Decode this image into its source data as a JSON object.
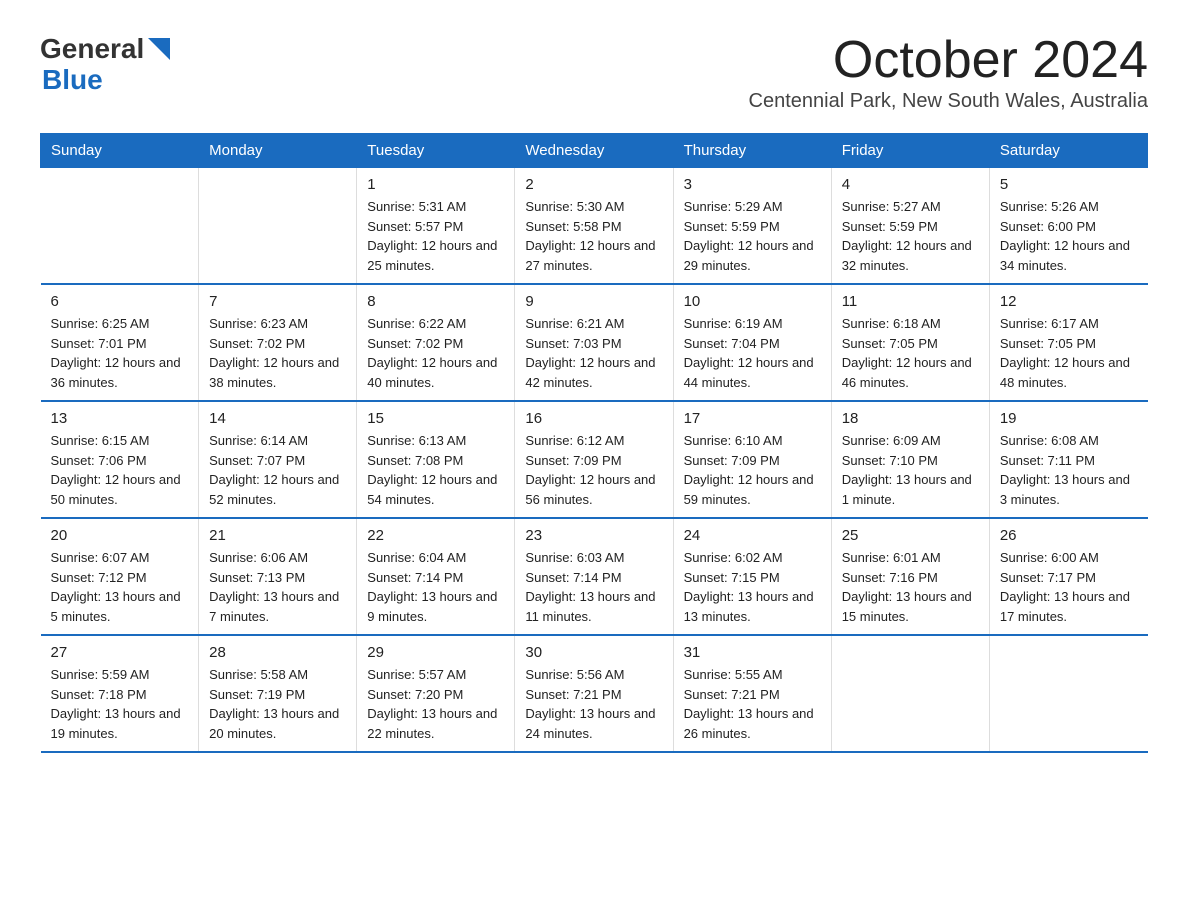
{
  "logo": {
    "general": "General",
    "blue": "Blue"
  },
  "title": "October 2024",
  "location": "Centennial Park, New South Wales, Australia",
  "headers": [
    "Sunday",
    "Monday",
    "Tuesday",
    "Wednesday",
    "Thursday",
    "Friday",
    "Saturday"
  ],
  "weeks": [
    [
      {
        "day": "",
        "sunrise": "",
        "sunset": "",
        "daylight": ""
      },
      {
        "day": "",
        "sunrise": "",
        "sunset": "",
        "daylight": ""
      },
      {
        "day": "1",
        "sunrise": "Sunrise: 5:31 AM",
        "sunset": "Sunset: 5:57 PM",
        "daylight": "Daylight: 12 hours and 25 minutes."
      },
      {
        "day": "2",
        "sunrise": "Sunrise: 5:30 AM",
        "sunset": "Sunset: 5:58 PM",
        "daylight": "Daylight: 12 hours and 27 minutes."
      },
      {
        "day": "3",
        "sunrise": "Sunrise: 5:29 AM",
        "sunset": "Sunset: 5:59 PM",
        "daylight": "Daylight: 12 hours and 29 minutes."
      },
      {
        "day": "4",
        "sunrise": "Sunrise: 5:27 AM",
        "sunset": "Sunset: 5:59 PM",
        "daylight": "Daylight: 12 hours and 32 minutes."
      },
      {
        "day": "5",
        "sunrise": "Sunrise: 5:26 AM",
        "sunset": "Sunset: 6:00 PM",
        "daylight": "Daylight: 12 hours and 34 minutes."
      }
    ],
    [
      {
        "day": "6",
        "sunrise": "Sunrise: 6:25 AM",
        "sunset": "Sunset: 7:01 PM",
        "daylight": "Daylight: 12 hours and 36 minutes."
      },
      {
        "day": "7",
        "sunrise": "Sunrise: 6:23 AM",
        "sunset": "Sunset: 7:02 PM",
        "daylight": "Daylight: 12 hours and 38 minutes."
      },
      {
        "day": "8",
        "sunrise": "Sunrise: 6:22 AM",
        "sunset": "Sunset: 7:02 PM",
        "daylight": "Daylight: 12 hours and 40 minutes."
      },
      {
        "day": "9",
        "sunrise": "Sunrise: 6:21 AM",
        "sunset": "Sunset: 7:03 PM",
        "daylight": "Daylight: 12 hours and 42 minutes."
      },
      {
        "day": "10",
        "sunrise": "Sunrise: 6:19 AM",
        "sunset": "Sunset: 7:04 PM",
        "daylight": "Daylight: 12 hours and 44 minutes."
      },
      {
        "day": "11",
        "sunrise": "Sunrise: 6:18 AM",
        "sunset": "Sunset: 7:05 PM",
        "daylight": "Daylight: 12 hours and 46 minutes."
      },
      {
        "day": "12",
        "sunrise": "Sunrise: 6:17 AM",
        "sunset": "Sunset: 7:05 PM",
        "daylight": "Daylight: 12 hours and 48 minutes."
      }
    ],
    [
      {
        "day": "13",
        "sunrise": "Sunrise: 6:15 AM",
        "sunset": "Sunset: 7:06 PM",
        "daylight": "Daylight: 12 hours and 50 minutes."
      },
      {
        "day": "14",
        "sunrise": "Sunrise: 6:14 AM",
        "sunset": "Sunset: 7:07 PM",
        "daylight": "Daylight: 12 hours and 52 minutes."
      },
      {
        "day": "15",
        "sunrise": "Sunrise: 6:13 AM",
        "sunset": "Sunset: 7:08 PM",
        "daylight": "Daylight: 12 hours and 54 minutes."
      },
      {
        "day": "16",
        "sunrise": "Sunrise: 6:12 AM",
        "sunset": "Sunset: 7:09 PM",
        "daylight": "Daylight: 12 hours and 56 minutes."
      },
      {
        "day": "17",
        "sunrise": "Sunrise: 6:10 AM",
        "sunset": "Sunset: 7:09 PM",
        "daylight": "Daylight: 12 hours and 59 minutes."
      },
      {
        "day": "18",
        "sunrise": "Sunrise: 6:09 AM",
        "sunset": "Sunset: 7:10 PM",
        "daylight": "Daylight: 13 hours and 1 minute."
      },
      {
        "day": "19",
        "sunrise": "Sunrise: 6:08 AM",
        "sunset": "Sunset: 7:11 PM",
        "daylight": "Daylight: 13 hours and 3 minutes."
      }
    ],
    [
      {
        "day": "20",
        "sunrise": "Sunrise: 6:07 AM",
        "sunset": "Sunset: 7:12 PM",
        "daylight": "Daylight: 13 hours and 5 minutes."
      },
      {
        "day": "21",
        "sunrise": "Sunrise: 6:06 AM",
        "sunset": "Sunset: 7:13 PM",
        "daylight": "Daylight: 13 hours and 7 minutes."
      },
      {
        "day": "22",
        "sunrise": "Sunrise: 6:04 AM",
        "sunset": "Sunset: 7:14 PM",
        "daylight": "Daylight: 13 hours and 9 minutes."
      },
      {
        "day": "23",
        "sunrise": "Sunrise: 6:03 AM",
        "sunset": "Sunset: 7:14 PM",
        "daylight": "Daylight: 13 hours and 11 minutes."
      },
      {
        "day": "24",
        "sunrise": "Sunrise: 6:02 AM",
        "sunset": "Sunset: 7:15 PM",
        "daylight": "Daylight: 13 hours and 13 minutes."
      },
      {
        "day": "25",
        "sunrise": "Sunrise: 6:01 AM",
        "sunset": "Sunset: 7:16 PM",
        "daylight": "Daylight: 13 hours and 15 minutes."
      },
      {
        "day": "26",
        "sunrise": "Sunrise: 6:00 AM",
        "sunset": "Sunset: 7:17 PM",
        "daylight": "Daylight: 13 hours and 17 minutes."
      }
    ],
    [
      {
        "day": "27",
        "sunrise": "Sunrise: 5:59 AM",
        "sunset": "Sunset: 7:18 PM",
        "daylight": "Daylight: 13 hours and 19 minutes."
      },
      {
        "day": "28",
        "sunrise": "Sunrise: 5:58 AM",
        "sunset": "Sunset: 7:19 PM",
        "daylight": "Daylight: 13 hours and 20 minutes."
      },
      {
        "day": "29",
        "sunrise": "Sunrise: 5:57 AM",
        "sunset": "Sunset: 7:20 PM",
        "daylight": "Daylight: 13 hours and 22 minutes."
      },
      {
        "day": "30",
        "sunrise": "Sunrise: 5:56 AM",
        "sunset": "Sunset: 7:21 PM",
        "daylight": "Daylight: 13 hours and 24 minutes."
      },
      {
        "day": "31",
        "sunrise": "Sunrise: 5:55 AM",
        "sunset": "Sunset: 7:21 PM",
        "daylight": "Daylight: 13 hours and 26 minutes."
      },
      {
        "day": "",
        "sunrise": "",
        "sunset": "",
        "daylight": ""
      },
      {
        "day": "",
        "sunrise": "",
        "sunset": "",
        "daylight": ""
      }
    ]
  ]
}
